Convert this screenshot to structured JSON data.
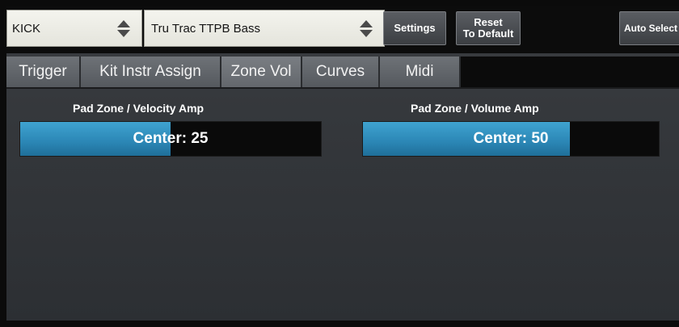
{
  "header": {
    "instrument_select": {
      "value": "KICK"
    },
    "kit_select": {
      "value": "Tru Trac TTPB Bass"
    },
    "settings_label": "Settings",
    "reset_label_1": "Reset",
    "reset_label_2": "To Default",
    "auto_select_label": "Auto Select"
  },
  "tabs": [
    {
      "label": "Trigger"
    },
    {
      "label": "Kit Instr Assign"
    },
    {
      "label": "Zone Vol",
      "active": true
    },
    {
      "label": "Curves"
    },
    {
      "label": "Midi"
    }
  ],
  "controls": {
    "velocity": {
      "label": "Pad Zone / Velocity Amp",
      "value_text": "Center: 25",
      "level": 0.5
    },
    "volume": {
      "label": "Pad Zone / Volume Amp",
      "value_text": "Center: 50",
      "level": 0.7
    }
  },
  "colors": {
    "accent": "#2e8fbf",
    "background": "#34373b"
  }
}
